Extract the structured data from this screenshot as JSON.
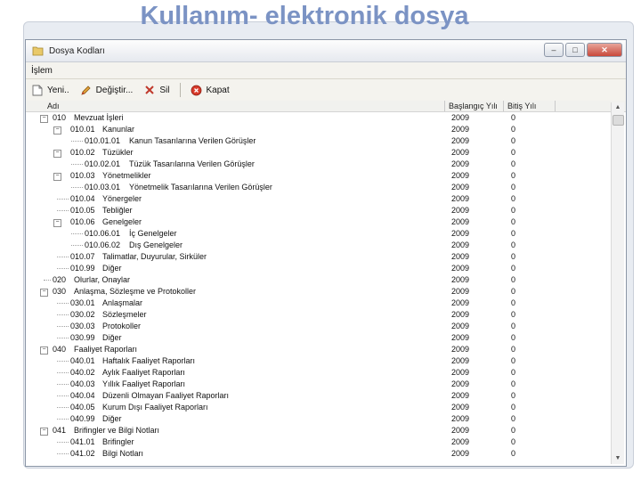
{
  "slide": {
    "title": "Kullanım- elektronik dosya"
  },
  "window": {
    "title": "Dosya Kodları",
    "buttons": {
      "minimize": "–",
      "maximize": "□",
      "close": "✕"
    }
  },
  "menu": {
    "items": [
      "İşlem"
    ]
  },
  "toolbar": {
    "new_label": "Yeni..",
    "edit_label": "Değiştir...",
    "delete_label": "Sil",
    "close_label": "Kapat"
  },
  "grid": {
    "headers": {
      "name": "Adı",
      "start_year": "Başlangıç Yılı",
      "end_year": "Bitiş Yılı"
    },
    "rows": [
      {
        "level": 0,
        "code": "010",
        "name": "Mevzuat İşleri",
        "start": "2009",
        "end": "0",
        "toggle": "−"
      },
      {
        "level": 1,
        "code": "010.01",
        "name": "Kanunlar",
        "start": "2009",
        "end": "0",
        "toggle": "−"
      },
      {
        "level": 2,
        "code": "010.01.01",
        "name": "Kanun Tasarılarına Verilen Görüşler",
        "start": "2009",
        "end": "0",
        "toggle": ""
      },
      {
        "level": 1,
        "code": "010.02",
        "name": "Tüzükler",
        "start": "2009",
        "end": "0",
        "toggle": "−"
      },
      {
        "level": 2,
        "code": "010.02.01",
        "name": "Tüzük Tasarılarına Verilen Görüşler",
        "start": "2009",
        "end": "0",
        "toggle": ""
      },
      {
        "level": 1,
        "code": "010.03",
        "name": "Yönetmelikler",
        "start": "2009",
        "end": "0",
        "toggle": "−"
      },
      {
        "level": 2,
        "code": "010.03.01",
        "name": "Yönetmelik Tasarılarına Verilen Görüşler",
        "start": "2009",
        "end": "0",
        "toggle": ""
      },
      {
        "level": 1,
        "code": "010.04",
        "name": "Yönergeler",
        "start": "2009",
        "end": "0",
        "toggle": ""
      },
      {
        "level": 1,
        "code": "010.05",
        "name": "Tebliğler",
        "start": "2009",
        "end": "0",
        "toggle": ""
      },
      {
        "level": 1,
        "code": "010.06",
        "name": "Genelgeler",
        "start": "2009",
        "end": "0",
        "toggle": "−"
      },
      {
        "level": 2,
        "code": "010.06.01",
        "name": "İç Genelgeler",
        "start": "2009",
        "end": "0",
        "toggle": ""
      },
      {
        "level": 2,
        "code": "010.06.02",
        "name": "Dış Genelgeler",
        "start": "2009",
        "end": "0",
        "toggle": ""
      },
      {
        "level": 1,
        "code": "010.07",
        "name": "Talimatlar, Duyurular, Sirküler",
        "start": "2009",
        "end": "0",
        "toggle": ""
      },
      {
        "level": 1,
        "code": "010.99",
        "name": "Diğer",
        "start": "2009",
        "end": "0",
        "toggle": ""
      },
      {
        "level": 0,
        "code": "020",
        "name": "Olurlar, Onaylar",
        "start": "2009",
        "end": "0",
        "toggle": ""
      },
      {
        "level": 0,
        "code": "030",
        "name": "Anlaşma, Sözleşme ve Protokoller",
        "start": "2009",
        "end": "0",
        "toggle": "−"
      },
      {
        "level": 1,
        "code": "030.01",
        "name": "Anlaşmalar",
        "start": "2009",
        "end": "0",
        "toggle": ""
      },
      {
        "level": 1,
        "code": "030.02",
        "name": "Sözleşmeler",
        "start": "2009",
        "end": "0",
        "toggle": ""
      },
      {
        "level": 1,
        "code": "030.03",
        "name": "Protokoller",
        "start": "2009",
        "end": "0",
        "toggle": ""
      },
      {
        "level": 1,
        "code": "030.99",
        "name": "Diğer",
        "start": "2009",
        "end": "0",
        "toggle": ""
      },
      {
        "level": 0,
        "code": "040",
        "name": "Faaliyet Raporları",
        "start": "2009",
        "end": "0",
        "toggle": "−"
      },
      {
        "level": 1,
        "code": "040.01",
        "name": "Haftalık Faaliyet Raporları",
        "start": "2009",
        "end": "0",
        "toggle": ""
      },
      {
        "level": 1,
        "code": "040.02",
        "name": "Aylık Faaliyet Raporları",
        "start": "2009",
        "end": "0",
        "toggle": ""
      },
      {
        "level": 1,
        "code": "040.03",
        "name": "Yıllık Faaliyet Raporları",
        "start": "2009",
        "end": "0",
        "toggle": ""
      },
      {
        "level": 1,
        "code": "040.04",
        "name": "Düzenli Olmayan Faaliyet Raporları",
        "start": "2009",
        "end": "0",
        "toggle": ""
      },
      {
        "level": 1,
        "code": "040.05",
        "name": "Kurum Dışı Faaliyet Raporları",
        "start": "2009",
        "end": "0",
        "toggle": ""
      },
      {
        "level": 1,
        "code": "040.99",
        "name": "Diğer",
        "start": "2009",
        "end": "0",
        "toggle": ""
      },
      {
        "level": 0,
        "code": "041",
        "name": "Brifingler ve Bilgi Notları",
        "start": "2009",
        "end": "0",
        "toggle": "−"
      },
      {
        "level": 1,
        "code": "041.01",
        "name": "Brifingler",
        "start": "2009",
        "end": "0",
        "toggle": ""
      },
      {
        "level": 1,
        "code": "041.02",
        "name": "Bilgi Notları",
        "start": "2009",
        "end": "0",
        "toggle": ""
      }
    ]
  },
  "colors": {
    "title": "#7b93c4",
    "window_bg": "#f4f3ee",
    "close_button": "#c8483a"
  },
  "icons": {
    "app": "folder-icon",
    "new": "new-file-icon",
    "edit": "pencil-icon",
    "delete": "red-x-icon",
    "close": "red-circle-icon"
  }
}
